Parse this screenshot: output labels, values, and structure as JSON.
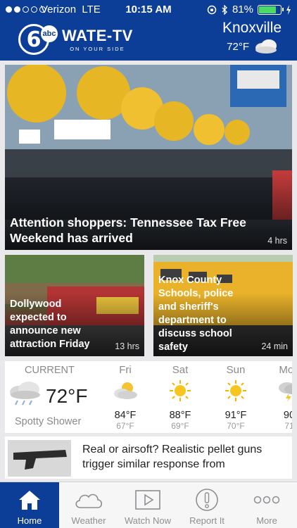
{
  "status_bar": {
    "carrier": "Verizon",
    "network": "LTE",
    "time": "10:15 AM",
    "battery_text": "81%",
    "battery_level": 0.81,
    "battery_color": "#4cd964"
  },
  "header": {
    "logo_number": "6",
    "logo_badge": "abc",
    "station_name": "WATE-TV",
    "tagline": "ON YOUR SIDE",
    "city": "Knoxville",
    "temperature": "72°F",
    "condition_icon": "cloud-icon",
    "brand_color": "#0d3e97"
  },
  "hero_story": {
    "title": "Attention shoppers: Tennessee Tax Free Weekend has arrived",
    "age": "4 hrs"
  },
  "stories": [
    {
      "title": "Dollywood expected to announce new attraction Friday",
      "age": "13 hrs"
    },
    {
      "title": "Knox County Schools, police and sheriff's department to discuss school safety",
      "age": "24 min"
    }
  ],
  "weather": {
    "current": {
      "label": "CURRENT",
      "temp": "72°F",
      "condition": "Spotty Shower",
      "icon": "rain-cloud-icon"
    },
    "forecast": [
      {
        "day": "Fri",
        "high": "84°F",
        "low": "67°F",
        "icon": "partly-cloudy-icon"
      },
      {
        "day": "Sat",
        "high": "88°F",
        "low": "69°F",
        "icon": "sunny-icon"
      },
      {
        "day": "Sun",
        "high": "91°F",
        "low": "70°F",
        "icon": "sunny-icon"
      },
      {
        "day": "Mon",
        "high": "90",
        "low": "71",
        "icon": "storm-icon"
      }
    ]
  },
  "news_item": {
    "title": "Real or airsoft? Realistic pellet guns trigger similar response from"
  },
  "tabs": [
    {
      "label": "Home",
      "icon": "home-icon",
      "active": true
    },
    {
      "label": "Weather",
      "icon": "cloud-icon",
      "active": false
    },
    {
      "label": "Watch Now",
      "icon": "play-icon",
      "active": false
    },
    {
      "label": "Report It",
      "icon": "alert-icon",
      "active": false
    },
    {
      "label": "More",
      "icon": "more-icon",
      "active": false
    }
  ]
}
